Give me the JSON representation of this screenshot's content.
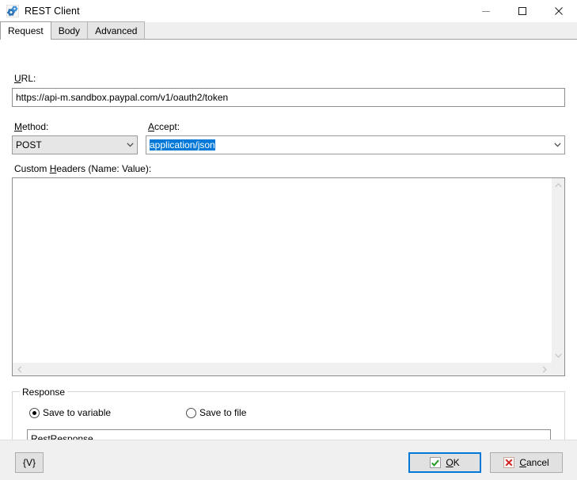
{
  "window": {
    "title": "REST Client",
    "icon": "gears-icon",
    "minimize_label": "Minimize",
    "maximize_label": "Maximize",
    "close_label": "Close"
  },
  "tabs": [
    {
      "label": "Request",
      "active": true
    },
    {
      "label": "Body",
      "active": false
    },
    {
      "label": "Advanced",
      "active": false
    }
  ],
  "request": {
    "url_label_pre": "",
    "url_label_accel": "U",
    "url_label_post": "RL:",
    "url_value": "https://api-m.sandbox.paypal.com/v1/oauth2/token",
    "method_label_accel": "M",
    "method_label_post": "ethod:",
    "method_value": "POST",
    "method_options": [
      "POST"
    ],
    "accept_label_accel": "A",
    "accept_label_post": "ccept:",
    "accept_value": "application/json",
    "accept_selected": true,
    "headers_label_pre": "Custom ",
    "headers_label_accel": "H",
    "headers_label_post": "eaders (Name: Value):",
    "headers_value": ""
  },
  "response": {
    "group_title": "Response",
    "save_to_variable_label": "Save to variable",
    "save_to_file_label": "Save to file",
    "selected_option": "variable",
    "variable_value": "RestResponse"
  },
  "footer": {
    "variables_button_label": "{V}",
    "ok_label_accel": "O",
    "ok_label_post": "K",
    "ok_icon": "check-icon",
    "cancel_label_accel": "C",
    "cancel_label_pre": "",
    "cancel_label_post": "ancel",
    "cancel_icon": "red-x-icon"
  },
  "colors": {
    "accent": "#0078d7",
    "selection": "#0078d7",
    "ok_icon": "#1f9c1f",
    "cancel_icon": "#d02020",
    "window_bg": "#ffffff",
    "footer_bg": "#f0f0f0"
  }
}
